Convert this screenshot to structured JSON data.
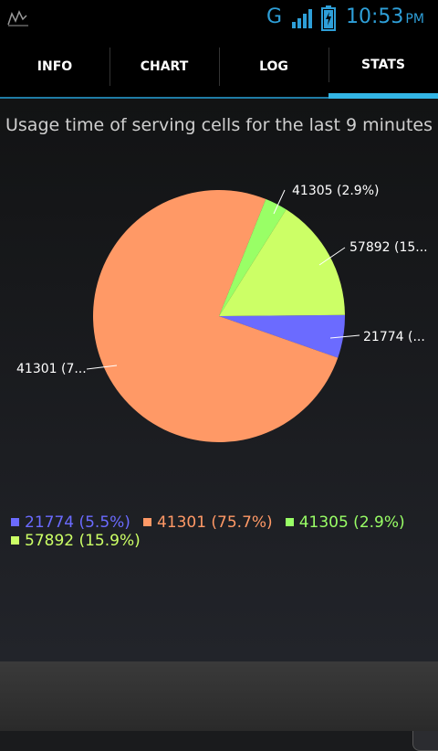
{
  "statusbar": {
    "network_label": "G",
    "time": "10:53",
    "ampm": "PM",
    "icons": [
      "activity-chart-icon",
      "signal-icon",
      "battery-charging-icon"
    ]
  },
  "tabs": [
    {
      "label": "INFO",
      "active": false
    },
    {
      "label": "CHART",
      "active": false
    },
    {
      "label": "LOG",
      "active": false
    },
    {
      "label": "STATS",
      "active": true
    }
  ],
  "chart_data": {
    "type": "pie",
    "title": "Usage time of serving cells for the last 9 minutes",
    "slices": [
      {
        "name": "21774",
        "percent": 5.5,
        "color": "#6b6bff",
        "legend": "21774 (5.5%)",
        "label": "21774 (..."
      },
      {
        "name": "41301",
        "percent": 75.7,
        "color": "#ff9966",
        "legend": "41301 (75.7%)",
        "label": "41301 (7..."
      },
      {
        "name": "41305",
        "percent": 2.9,
        "color": "#99ff66",
        "legend": "41305 (2.9%)",
        "label": "41305 (2.9%)"
      },
      {
        "name": "57892",
        "percent": 15.9,
        "color": "#ccff66",
        "legend": "57892 (15.9%)",
        "label": "57892 (15..."
      }
    ]
  }
}
